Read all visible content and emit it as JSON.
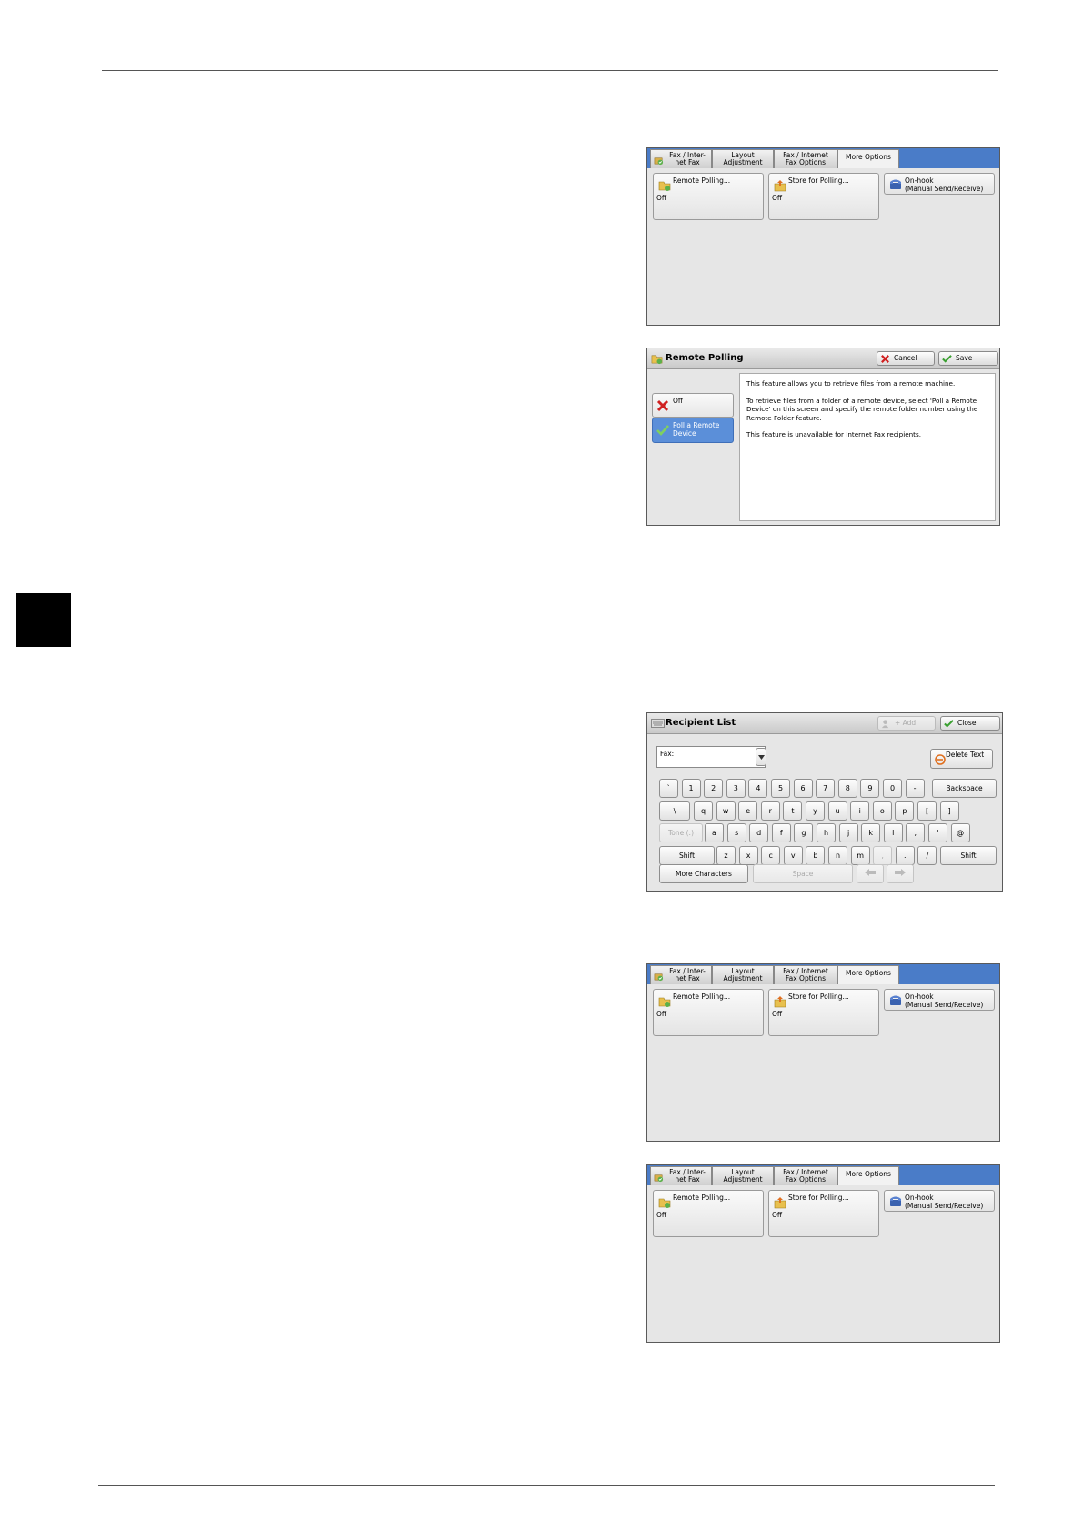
{
  "tabs_screen": {
    "tabs": [
      {
        "label": "Fax / Inter-\nnet Fax"
      },
      {
        "label": "Layout\nAdjustment"
      },
      {
        "label": "Fax / Internet\nFax Options"
      },
      {
        "label": "More Options"
      }
    ],
    "features": {
      "remote_polling": {
        "name": "Remote Polling...",
        "value": "Off"
      },
      "store_for_polling": {
        "name": "Store for Polling...",
        "value": "Off"
      },
      "on_hook": {
        "name": "On-hook\n(Manual Send/Receive)"
      }
    }
  },
  "remote_polling_screen": {
    "title": "Remote Polling",
    "cancel_label": "Cancel",
    "save_label": "Save",
    "options": [
      {
        "label": "Off"
      },
      {
        "label": "Poll a Remote\nDevice"
      }
    ],
    "description": [
      "This feature allows you to retrieve files from a remote machine.",
      "To retrieve files from a folder of a remote device, select 'Poll a Remote Device' on this screen and specify the remote folder number using the Remote Folder feature.",
      "This feature is unavailable for Internet Fax recipients."
    ]
  },
  "recipient_list_screen": {
    "title": "Recipient List",
    "add_label": "+ Add",
    "close_label": "Close",
    "field_label": "Fax:",
    "delete_text_label": "Delete Text",
    "row1": [
      "`",
      "1",
      "2",
      "3",
      "4",
      "5",
      "6",
      "7",
      "8",
      "9",
      "0",
      "-"
    ],
    "backspace_label": "Backspace",
    "row2": [
      "\\",
      "q",
      "w",
      "e",
      "r",
      "t",
      "y",
      "u",
      "i",
      "o",
      "p",
      "[",
      "]"
    ],
    "tone_label": "Tone (:)",
    "row3": [
      "a",
      "s",
      "d",
      "f",
      "g",
      "h",
      "j",
      "k",
      "l",
      ";",
      "'",
      "@"
    ],
    "shift_label": "Shift",
    "row4": [
      "z",
      "x",
      "c",
      "v",
      "b",
      "n",
      "m",
      ",",
      ".",
      "/"
    ],
    "more_characters_label": "More Characters",
    "space_label": "Space"
  }
}
